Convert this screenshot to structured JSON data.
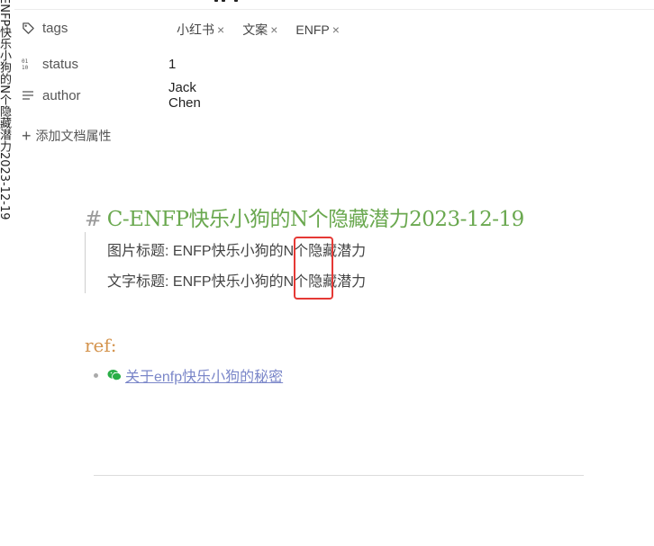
{
  "sidebar": {
    "vertical_title": "ENFP快乐小狗的N个隐藏潜力2023-12-19"
  },
  "properties": {
    "tags": {
      "key": "tags",
      "values": [
        "小红书",
        "文案",
        "ENFP"
      ],
      "remove_glyph": "×"
    },
    "status": {
      "key": "status",
      "value": "1"
    },
    "author": {
      "key": "author",
      "value": "Jack Chen"
    },
    "add_label": "添加文档属性"
  },
  "document": {
    "heading_hash": "#",
    "heading": "C-ENFP快乐小狗的N个隐藏潜力2023-12-19",
    "quote_lines": [
      "图片标题: ENFP快乐小狗的N个隐藏潜力",
      "文字标题: ENFP快乐小狗的N个隐藏潜力"
    ],
    "ref_label": "ref:",
    "ref_link": "关于enfp快乐小狗的秘密"
  },
  "colors": {
    "heading": "#6aa84f",
    "ref": "#d4944e",
    "link": "#7b87c9",
    "highlight": "#e53935"
  }
}
